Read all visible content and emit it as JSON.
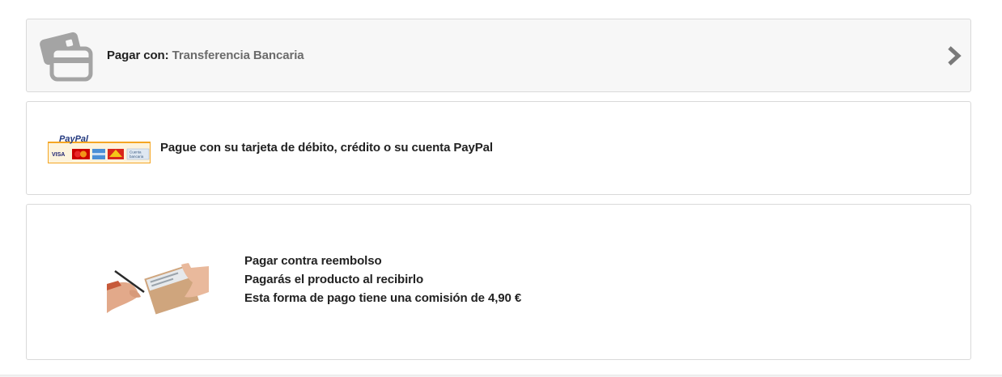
{
  "header": {
    "icon": "credit-card-icon",
    "label": "Pagar con:",
    "selected_method": "Transferencia Bancaria",
    "chevron_icon": "chevron-right-icon"
  },
  "paypal": {
    "logo_icon": "paypal-logo-icon",
    "logo_text": "PayPal",
    "logo_cards": [
      "VISA",
      "MasterCard",
      "AmEx",
      "Maestro",
      "Cuenta bancaria"
    ],
    "description": "Pague con su tarjeta de débito, crédito o su cuenta PayPal"
  },
  "cod": {
    "image": "package-delivery-handover-image",
    "title": "Pagar contra reembolso",
    "line2": "Pagarás el producto al recibirlo",
    "line3": "Esta forma de pago tiene una comisión de 4,90 €"
  },
  "colors": {
    "border": "#d9d9d9",
    "header_bg": "#f7f7f7",
    "icon_gray": "#9a9a9a",
    "text": "#222222",
    "muted_text": "#6b6b6b",
    "paypal_blue": "#253b80",
    "paypal_orange": "#f5a623"
  }
}
